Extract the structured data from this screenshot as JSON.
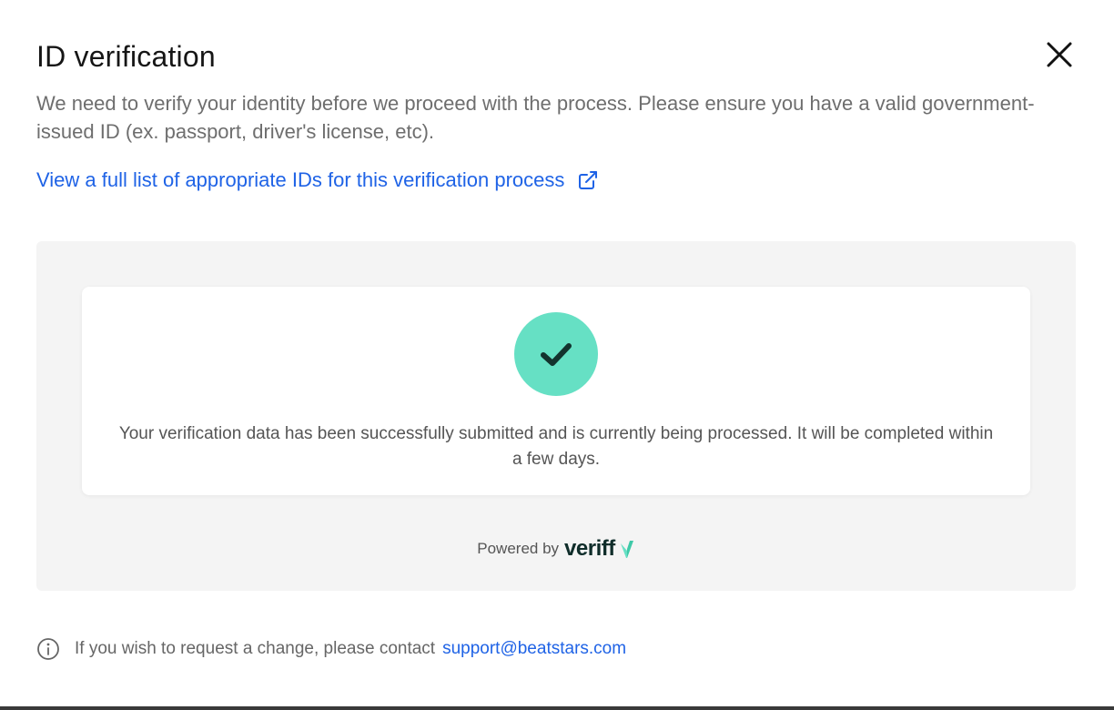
{
  "dialog": {
    "title": "ID verification",
    "description": "We need to verify your identity before we proceed with the process. Please ensure you have a valid government-issued ID (ex. passport, driver's license, etc).",
    "ids_link_label": "View a full list of appropriate IDs for this verification process",
    "close_icon": "close-icon",
    "external_link_icon": "external-link-icon"
  },
  "status_card": {
    "icon": "checkmark-icon",
    "message": "Your verification data has been successfully submitted and is currently being processed. It will be completed within a few days.",
    "check_color": "#66e0c4"
  },
  "powered_by": {
    "label": "Powered by",
    "brand": "veriff"
  },
  "footer": {
    "icon": "info-icon",
    "text": "If you wish to request a change, please contact",
    "support_email": "support@beatstars.com"
  },
  "colors": {
    "link": "#1f63e6",
    "panel_bg": "#f4f4f4",
    "brand_mark": "#66e0c4"
  }
}
